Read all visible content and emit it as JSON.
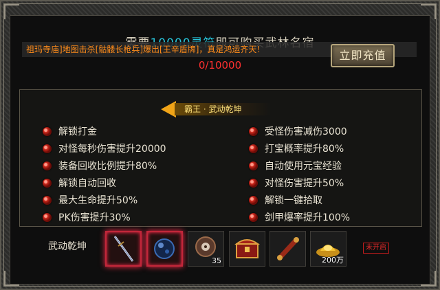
{
  "header": {
    "prefix": "需要",
    "amount": "10000灵符",
    "suffix": "即可购买武林名宿",
    "ticker": "祖玛寺庙]地图击杀[骷髅长枪兵]爆出[王辛盾牌]，真是鸿运齐天！",
    "progress": "0/10000",
    "recharge_label": "立即充值"
  },
  "badge": {
    "label": "霸王 · 武动乾坤"
  },
  "perks_left": [
    "解锁打金",
    "对怪每秒伤害提升20000",
    "装备回收比例提升80%",
    "解锁自动回收",
    "最大生命提升50%",
    "PK伤害提升30%"
  ],
  "perks_right": [
    "受怪伤害减伤3000",
    "打宝概率提升80%",
    "自动使用元宝经验",
    "对怪伤害提升50%",
    "解锁一键拾取",
    "剑甲爆率提升100%"
  ],
  "rewards": {
    "label": "武动乾坤",
    "items": [
      {
        "icon": "sword-icon",
        "count": ""
      },
      {
        "icon": "orb-icon",
        "count": ""
      },
      {
        "icon": "disc-icon",
        "count": "35"
      },
      {
        "icon": "chest-icon",
        "count": ""
      },
      {
        "icon": "scroll-icon",
        "count": ""
      },
      {
        "icon": "gold-ingot-icon",
        "count": "200万"
      }
    ],
    "status": "未开启"
  },
  "colors": {
    "amount": "#27c3d9",
    "ticker": "#ff8c1a",
    "progress": "#ff3030",
    "badge": "#ffe27a",
    "highlight": "#c2273a"
  }
}
